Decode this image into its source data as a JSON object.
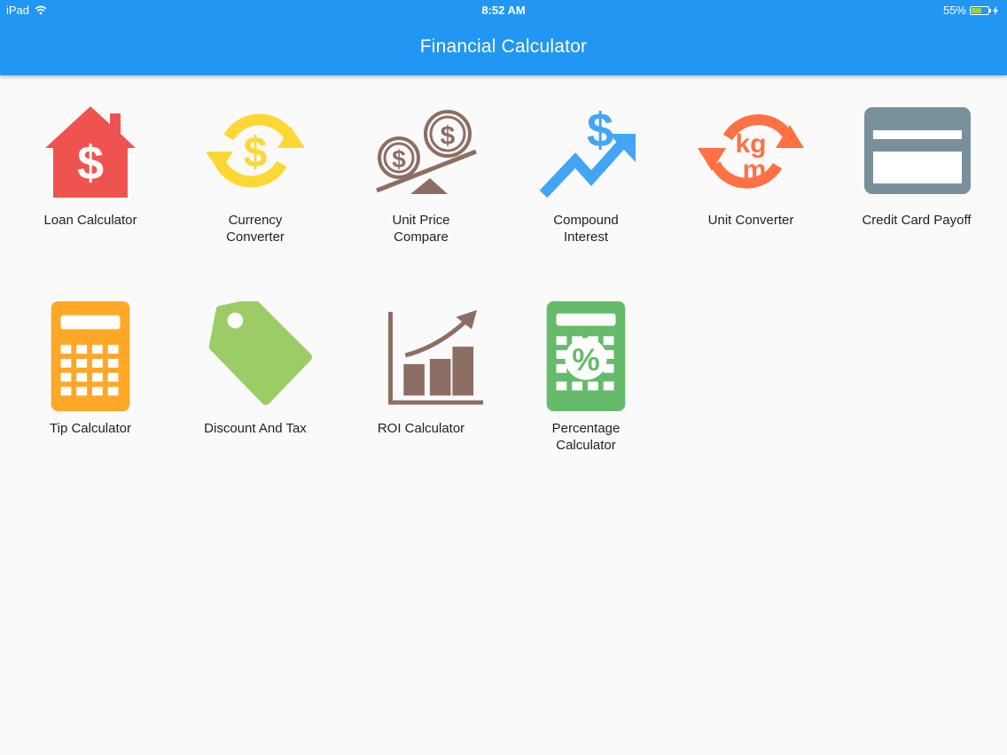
{
  "status_bar": {
    "device": "iPad",
    "time": "8:52 AM",
    "battery": "55%",
    "battery_level": 0.55
  },
  "app": {
    "title": "Financial Calculator"
  },
  "tiles": [
    {
      "label": "Loan Calculator",
      "icon": "house-dollar-icon",
      "color": "#ef5350"
    },
    {
      "label": "Currency Converter",
      "icon": "currency-exchange-icon",
      "color": "#fdd835"
    },
    {
      "label": "Unit Price Compare",
      "icon": "coin-balance-icon",
      "color": "#8d6e63"
    },
    {
      "label": "Compound Interest",
      "icon": "dollar-trend-up-icon",
      "color": "#42a5f5"
    },
    {
      "label": "Unit Converter",
      "icon": "kg-m-convert-icon",
      "color": "#ff7043"
    },
    {
      "label": "Credit Card Payoff",
      "icon": "credit-card-icon",
      "color": "#78909c"
    },
    {
      "label": "Tip Calculator",
      "icon": "calculator-icon",
      "color": "#ffa726"
    },
    {
      "label": "Discount And Tax",
      "icon": "price-tag-icon",
      "color": "#9ccc65"
    },
    {
      "label": "ROI Calculator",
      "icon": "bar-chart-growth-icon",
      "color": "#8d6e63"
    },
    {
      "label": "Percentage Calculator",
      "icon": "percent-calculator-icon",
      "color": "#66bb6a"
    }
  ]
}
